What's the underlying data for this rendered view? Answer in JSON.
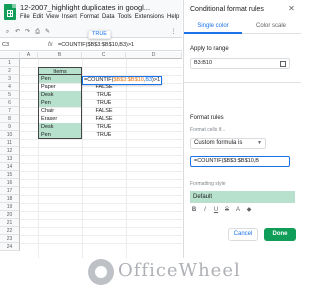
{
  "app": {
    "doc_title": "12-2007_highlight duplicates in googl...",
    "menu": [
      "File",
      "Edit",
      "View",
      "Insert",
      "Format",
      "Data",
      "Tools",
      "Extensions",
      "Help"
    ],
    "tooltip": "TRUE"
  },
  "formula_bar": {
    "cell_ref": "C3",
    "fx": "fx",
    "content": "=COUNTIF($B$3:$B$10,B3)>1"
  },
  "grid": {
    "columns": [
      "A",
      "B",
      "C",
      "D"
    ],
    "rows": [
      "1",
      "2",
      "3",
      "4",
      "5",
      "6",
      "7",
      "8",
      "9",
      "10",
      "11",
      "12",
      "13",
      "14",
      "15",
      "16",
      "17",
      "18",
      "19",
      "20",
      "21",
      "22",
      "23",
      "24"
    ],
    "header": "Items",
    "items": [
      "Pen",
      "Paper",
      "Desk",
      "Pen",
      "Chair",
      "Eraser",
      "Desk",
      "Pen"
    ],
    "results": [
      "",
      "FALSE",
      "TRUE",
      "TRUE",
      "FALSE",
      "FALSE",
      "TRUE",
      "TRUE"
    ],
    "editor": {
      "prefix": "=COUNTIF(",
      "range": "$B$3:$B$10",
      "sep": ",",
      "ref": "B3",
      "suffix": ")>1"
    }
  },
  "watermark": "OfficeWheel",
  "panel": {
    "title": "Conditional format rules",
    "tabs": [
      "Single color",
      "Color scale"
    ],
    "apply_label": "Apply to range",
    "range_value": "B3:B10",
    "rules_label": "Format rules",
    "format_if": "Format cells if...",
    "condition": "Custom formula is",
    "formula_value": "=COUNTIF($B$3:$B$10,B",
    "style_label": "Formatting style",
    "style_value": "Default",
    "cancel": "Cancel",
    "done": "Done"
  },
  "colors": {
    "accent": "#1a73e8",
    "highlight": "#b7e1cd",
    "done": "#0f9d58"
  }
}
